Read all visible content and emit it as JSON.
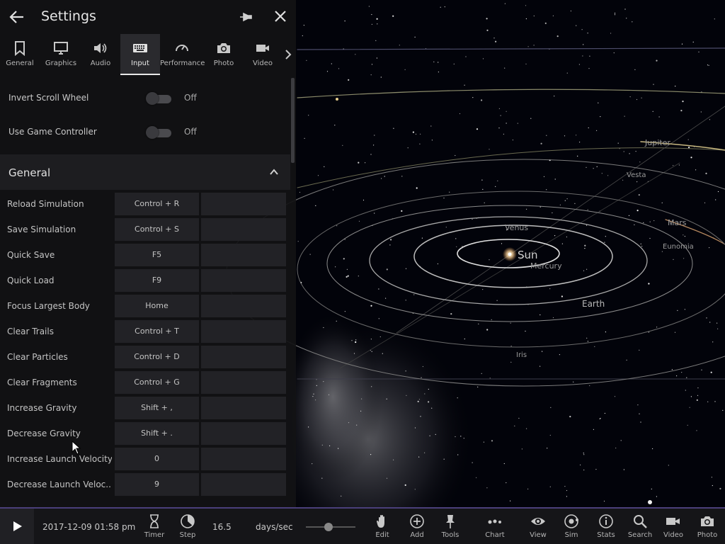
{
  "settings": {
    "title": "Settings",
    "tabs": [
      {
        "label": "General",
        "icon": "bookmark-icon"
      },
      {
        "label": "Graphics",
        "icon": "monitor-icon"
      },
      {
        "label": "Audio",
        "icon": "speaker-icon"
      },
      {
        "label": "Input",
        "icon": "keyboard-icon",
        "active": true
      },
      {
        "label": "Performance",
        "icon": "speedometer-icon"
      },
      {
        "label": "Photo",
        "icon": "camera-icon"
      },
      {
        "label": "Video",
        "icon": "video-camera-icon"
      }
    ],
    "toggles": [
      {
        "label": "Invert Scroll Wheel",
        "state": "Off"
      },
      {
        "label": "Use Game Controller",
        "state": "Off"
      }
    ],
    "section_title": "General",
    "keybindings": [
      {
        "name": "Reload Simulation",
        "key": "Control + R"
      },
      {
        "name": "Save Simulation",
        "key": "Control + S"
      },
      {
        "name": "Quick Save",
        "key": "F5"
      },
      {
        "name": "Quick Load",
        "key": "F9"
      },
      {
        "name": "Focus Largest Body",
        "key": "Home"
      },
      {
        "name": "Clear Trails",
        "key": "Control + T"
      },
      {
        "name": "Clear Particles",
        "key": "Control + D"
      },
      {
        "name": "Clear Fragments",
        "key": "Control + G"
      },
      {
        "name": "Increase Gravity",
        "key": "Shift + ,"
      },
      {
        "name": "Decrease Gravity",
        "key": "Shift + ."
      },
      {
        "name": "Increase Launch Velocity",
        "key": "0"
      },
      {
        "name": "Decrease Launch Veloc...",
        "key": "9"
      }
    ]
  },
  "space": {
    "labels": {
      "sun": "Sun",
      "mercury": "Mercury",
      "venus": "Venus",
      "earth": "Earth",
      "mars": "Mars",
      "jupiter": "Jupiter",
      "vesta": "Vesta",
      "eunomia": "Eunomia",
      "iris": "Iris"
    }
  },
  "toolbar": {
    "date": "2017-12-09 01:58 pm",
    "timer_label": "Timer",
    "step_label": "Step",
    "rate_value": "16.5",
    "rate_unit": "days/sec",
    "speed_slider_level": 0.45,
    "buttons": [
      {
        "label": "Edit",
        "icon": "hand-icon"
      },
      {
        "label": "Add",
        "icon": "plus-circle-icon"
      },
      {
        "label": "Tools",
        "icon": "pin-tool-icon"
      },
      {
        "label": "Chart",
        "icon": "chart-dots-icon"
      },
      {
        "label": "View",
        "icon": "eye-icon"
      },
      {
        "label": "Sim",
        "icon": "orbit-icon"
      },
      {
        "label": "Stats",
        "icon": "info-icon"
      },
      {
        "label": "Search",
        "icon": "search-icon"
      },
      {
        "label": "Video",
        "icon": "video-camera-icon"
      },
      {
        "label": "Photo",
        "icon": "camera-icon"
      }
    ]
  },
  "colors": {
    "panel": "#121214",
    "accent_border": "#4a3f7a",
    "orbit": "#c8c8c8",
    "sun": "#ffe6b0"
  }
}
